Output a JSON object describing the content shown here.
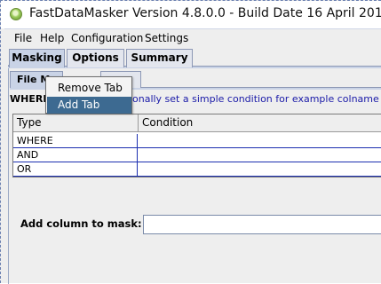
{
  "window": {
    "title": "FastDataMasker Version 4.8.0.0 - Build Date 16 April 2019"
  },
  "menubar": {
    "items": [
      "File",
      "Help",
      "Configuration",
      "Settings"
    ]
  },
  "main_tabs": [
    {
      "label": "Masking",
      "active": true
    },
    {
      "label": "Options",
      "active": false
    },
    {
      "label": "Summary",
      "active": false
    }
  ],
  "sub_tabs": [
    {
      "label": "File M",
      "active": true
    }
  ],
  "where_section": {
    "label": "WHERE",
    "hint": "onally set a simple condition for example colname ="
  },
  "table": {
    "headers": [
      "Type",
      "Condition"
    ],
    "rows": [
      {
        "type": "WHERE",
        "condition": ""
      },
      {
        "type": "AND",
        "condition": ""
      },
      {
        "type": "OR",
        "condition": ""
      }
    ]
  },
  "mask_column": {
    "label": "Add column to mask:",
    "value": ""
  },
  "context_menu": {
    "items": [
      {
        "label": "Remove Tab",
        "selected": false
      },
      {
        "label": "Add Tab",
        "selected": true
      }
    ]
  },
  "colors": {
    "selection": "#3d6a91",
    "table_grid": "#1c2fb0",
    "hint_text": "#1a1aa8"
  }
}
